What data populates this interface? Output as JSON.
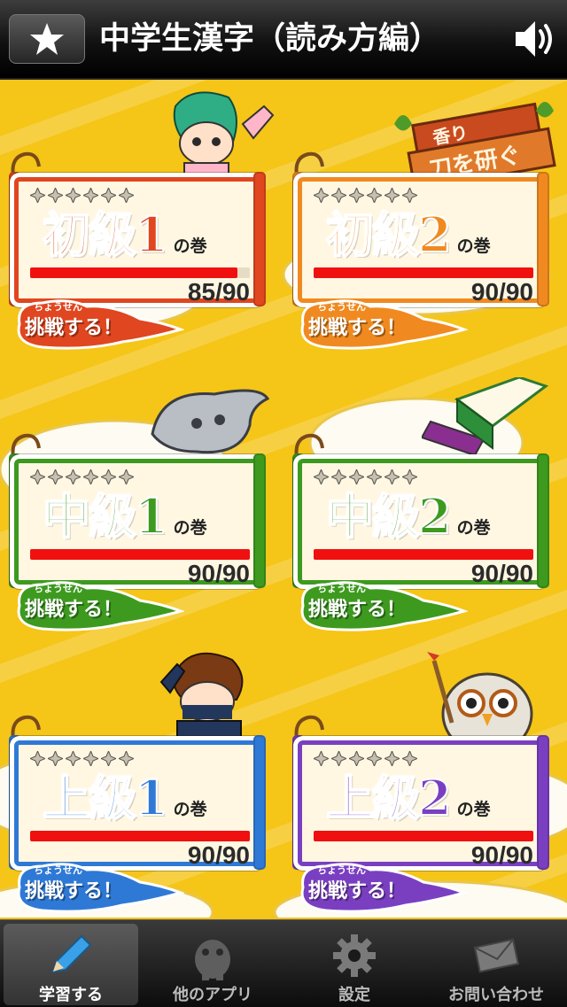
{
  "header": {
    "title": "中学生漢字（読み方編）",
    "favorite_icon": "star-icon",
    "sound_icon": "speaker-icon"
  },
  "cards": [
    {
      "level": "初級1",
      "suffix": "の巻",
      "score": "85/90",
      "progress": 0.944,
      "color": "#e0461f",
      "stars_filled": 0,
      "stars_total": 6,
      "challenge_ruby": "ちょうせん",
      "challenge_text": "挑戦する！"
    },
    {
      "level": "初級2",
      "suffix": "の巻",
      "score": "90/90",
      "progress": 1.0,
      "color": "#f08a20",
      "stars_filled": 0,
      "stars_total": 6,
      "challenge_ruby": "ちょうせん",
      "challenge_text": "挑戦する！"
    },
    {
      "level": "中級1",
      "suffix": "の巻",
      "score": "90/90",
      "progress": 1.0,
      "color": "#3d9a1f",
      "stars_filled": 0,
      "stars_total": 6,
      "challenge_ruby": "ちょうせん",
      "challenge_text": "挑戦する！"
    },
    {
      "level": "中級2",
      "suffix": "の巻",
      "score": "90/90",
      "progress": 1.0,
      "color": "#3d9a1f",
      "stars_filled": 0,
      "stars_total": 6,
      "challenge_ruby": "ちょうせん",
      "challenge_text": "挑戦する！"
    },
    {
      "level": "上級1",
      "suffix": "の巻",
      "score": "90/90",
      "progress": 1.0,
      "color": "#2f79d6",
      "stars_filled": 0,
      "stars_total": 6,
      "challenge_ruby": "ちょうせん",
      "challenge_text": "挑戦する！"
    },
    {
      "level": "上級2",
      "suffix": "の巻",
      "score": "90/90",
      "progress": 1.0,
      "color": "#7a3fc1",
      "stars_filled": 0,
      "stars_total": 6,
      "challenge_ruby": "ちょうせん",
      "challenge_text": "挑戦する！"
    }
  ],
  "signboard": {
    "line1": "香り",
    "line2": "刀を研ぐ"
  },
  "tabs": [
    {
      "label": "学習する",
      "icon": "pencil-icon",
      "active": true
    },
    {
      "label": "他のアプリ",
      "icon": "mascot-icon",
      "active": false
    },
    {
      "label": "設定",
      "icon": "gear-icon",
      "active": false
    },
    {
      "label": "お問い合わせ",
      "icon": "envelope-icon",
      "active": false
    }
  ]
}
